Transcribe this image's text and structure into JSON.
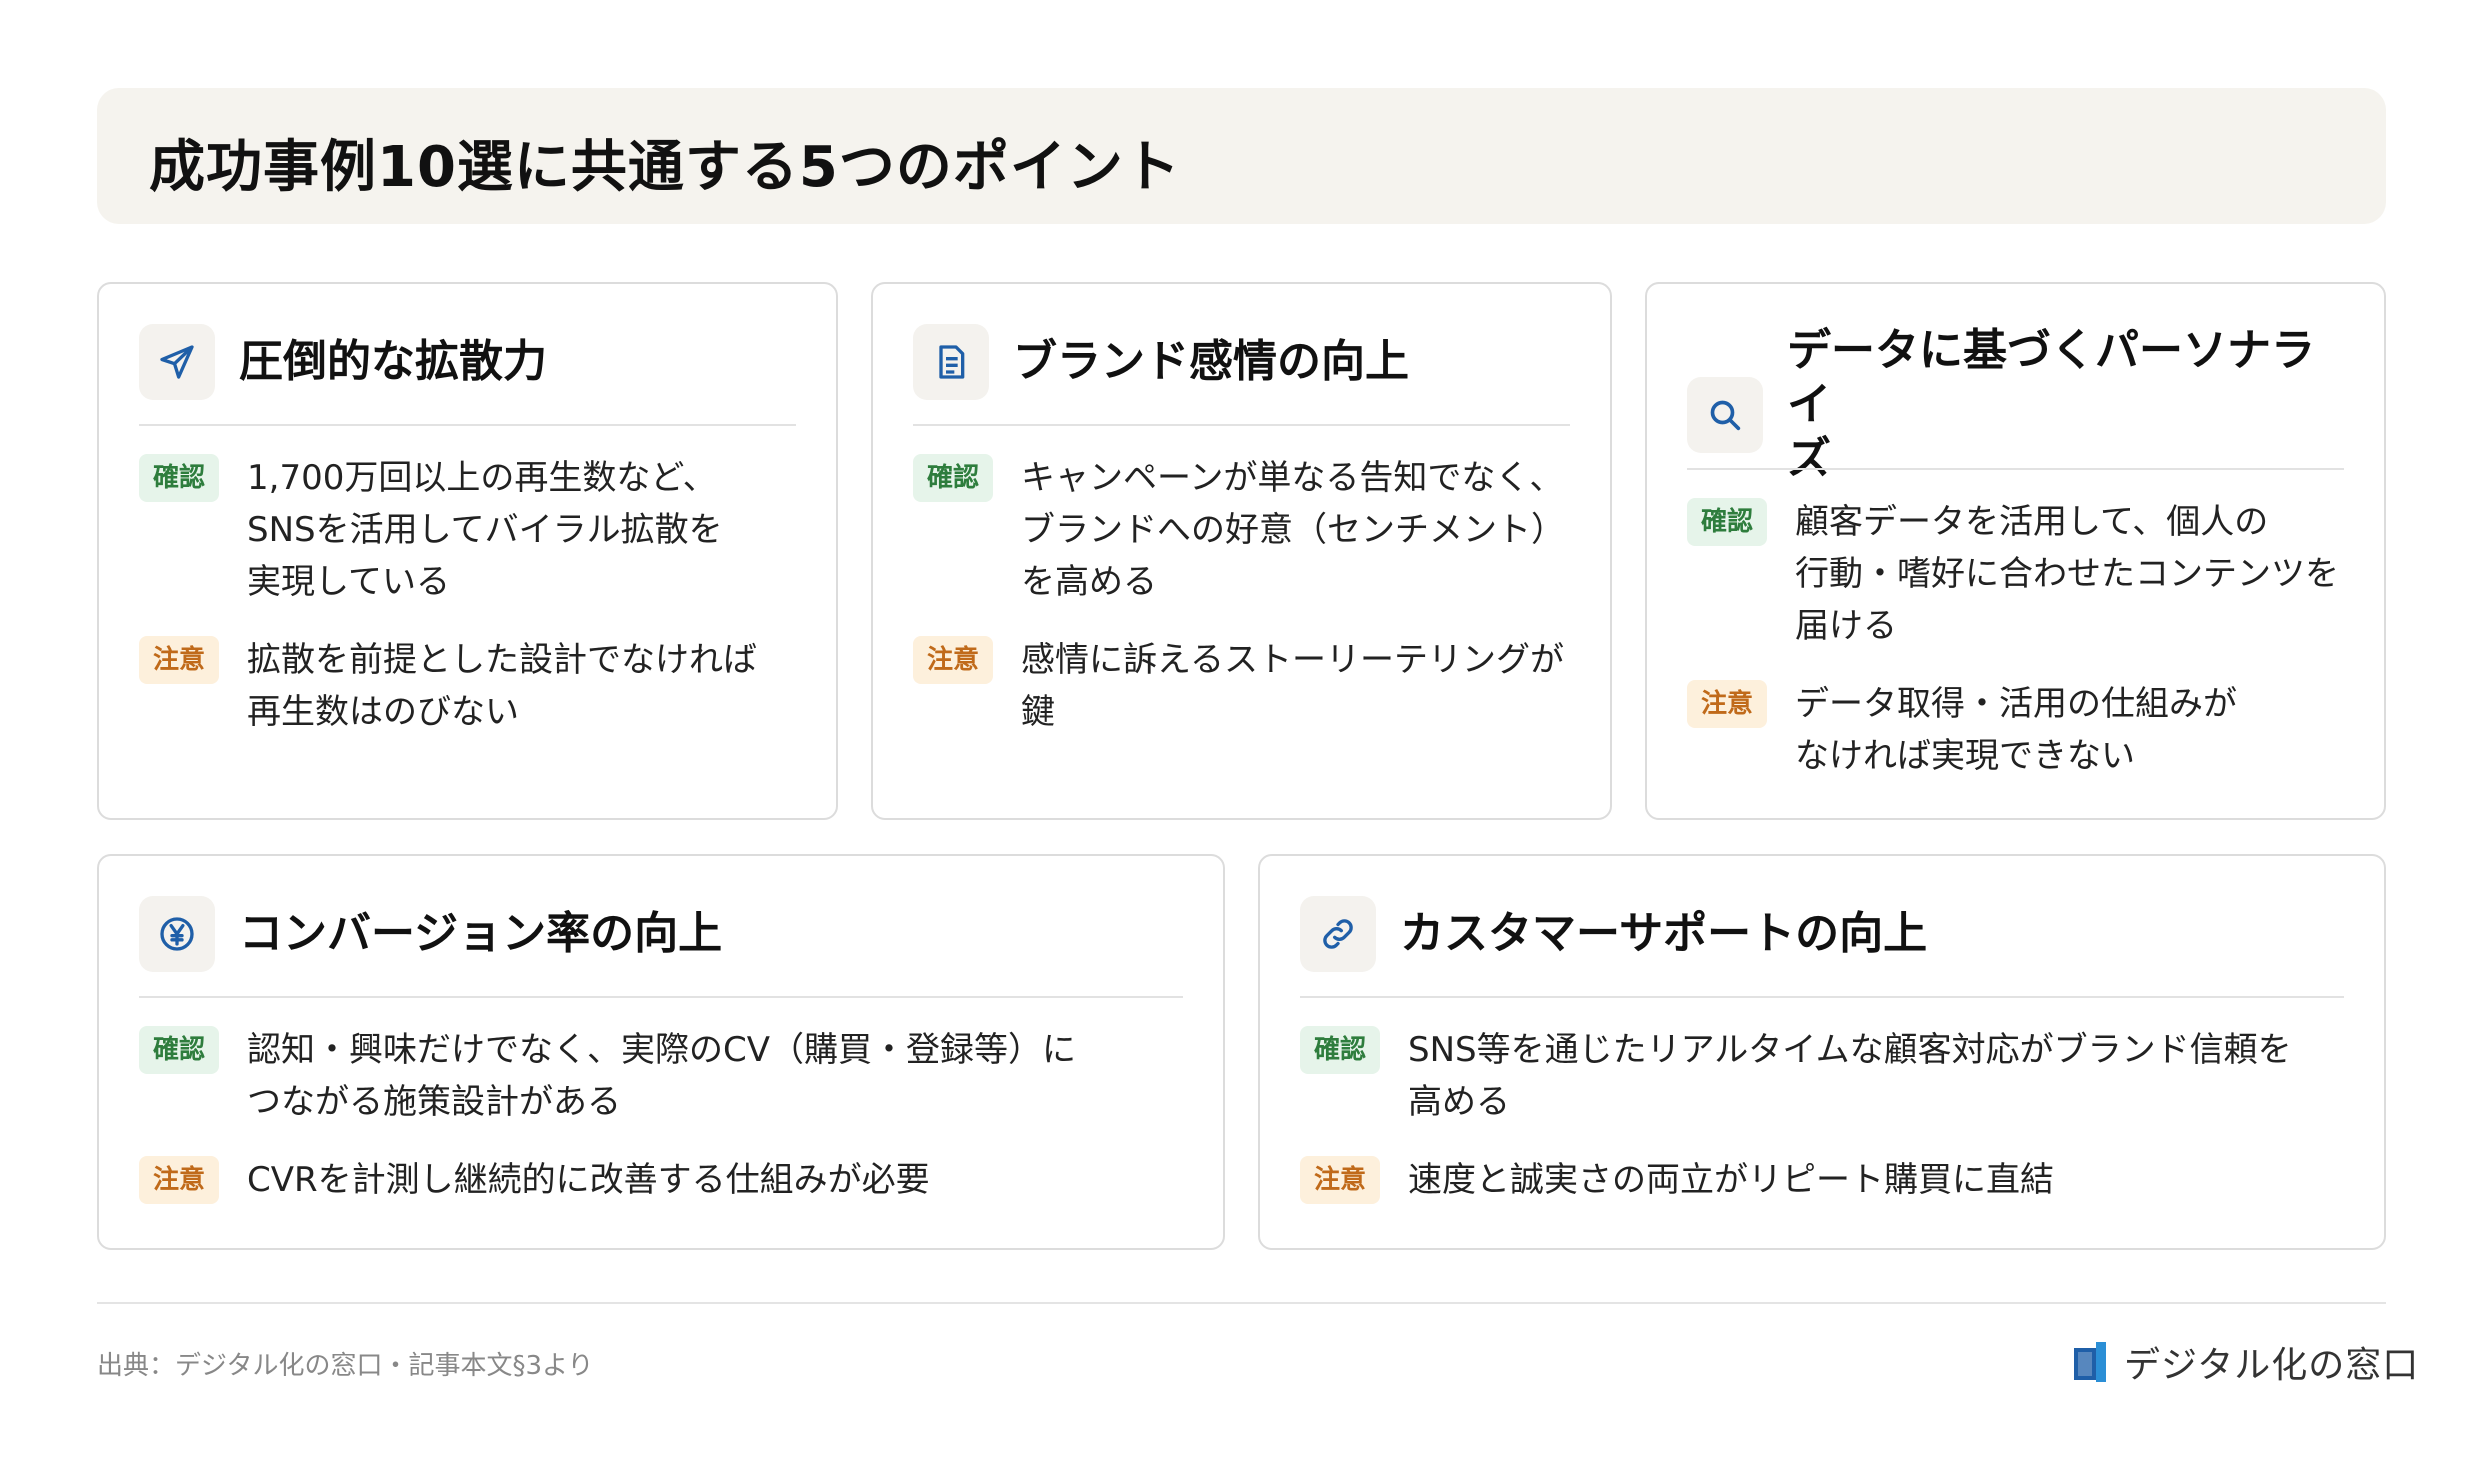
{
  "header": {
    "title": "成功事例10選に共通する5つのポイント"
  },
  "cards": [
    {
      "title": "圧倒的な拡散力",
      "icon": "send-icon",
      "confirm_label": "確認",
      "confirm_text": "1,700万回以上の再生数など、\nSNSを活用してバイラル拡散を\n実現している",
      "caution_label": "注意",
      "caution_text": "拡散を前提とした設計でなければ\n再生数はのびない"
    },
    {
      "title": "ブランド感情の向上",
      "icon": "document-icon",
      "confirm_label": "確認",
      "confirm_text": "キャンペーンが単なる告知でなく、\nブランドへの好意（センチメント）\nを高める",
      "caution_label": "注意",
      "caution_text": "感情に訴えるストーリーテリングが\n鍵"
    },
    {
      "title": "データに基づくパーソナライ\nズ",
      "icon": "search-icon",
      "confirm_label": "確認",
      "confirm_text": "顧客データを活用して、個人の\n行動・嗜好に合わせたコンテンツを\n届ける",
      "caution_label": "注意",
      "caution_text": "データ取得・活用の仕組みが\nなければ実現できない"
    },
    {
      "title": "コンバージョン率の向上",
      "icon": "yen-icon",
      "confirm_label": "確認",
      "confirm_text": "認知・興味だけでなく、実際のCV（購買・登録等）に\nつながる施策設計がある",
      "caution_label": "注意",
      "caution_text": "CVRを計測し継続的に改善する仕組みが必要"
    },
    {
      "title": "カスタマーサポートの向上",
      "icon": "link-icon",
      "confirm_label": "確認",
      "confirm_text": "SNS等を通じたリアルタイムな顧客対応がブランド信頼を\n高める",
      "caution_label": "注意",
      "caution_text": "速度と誠実さの両立がリピート購買に直結"
    }
  ],
  "footer": {
    "source": "出典：デジタル化の窓口・記事本文§3より",
    "logo_text": "デジタル化の窓口"
  },
  "colors": {
    "header_bg": "#f5f3ee",
    "confirm": "#2e7d3d",
    "caution": "#c06a1a",
    "icon": "#1f5fa8"
  }
}
